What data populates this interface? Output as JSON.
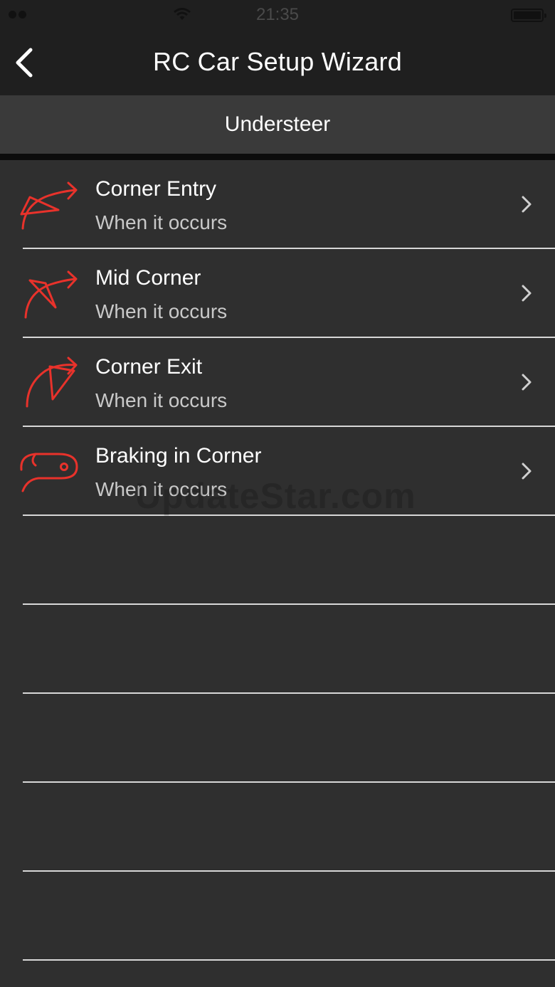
{
  "status_bar": {
    "time": "21:35",
    "icons": [
      "signal-dots-icon",
      "wifi-icon",
      "battery-icon"
    ]
  },
  "nav": {
    "title": "RC Car Setup Wizard",
    "back_icon": "chevron-left-icon"
  },
  "section": {
    "title": "Understeer"
  },
  "items": [
    {
      "title": "Corner Entry",
      "subtitle": "When it occurs",
      "icon": "corner-entry-icon"
    },
    {
      "title": "Mid Corner",
      "subtitle": "When it occurs",
      "icon": "mid-corner-icon"
    },
    {
      "title": "Corner Exit",
      "subtitle": "When it occurs",
      "icon": "corner-exit-icon"
    },
    {
      "title": "Braking in Corner",
      "subtitle": "When it occurs",
      "icon": "braking-in-corner-icon"
    }
  ],
  "watermark": "UpdateStar.com",
  "colors": {
    "accent": "#e8322b",
    "background": "#2f2f2f",
    "nav_background": "#1f1f1f",
    "section_background": "#3a3a3a"
  }
}
